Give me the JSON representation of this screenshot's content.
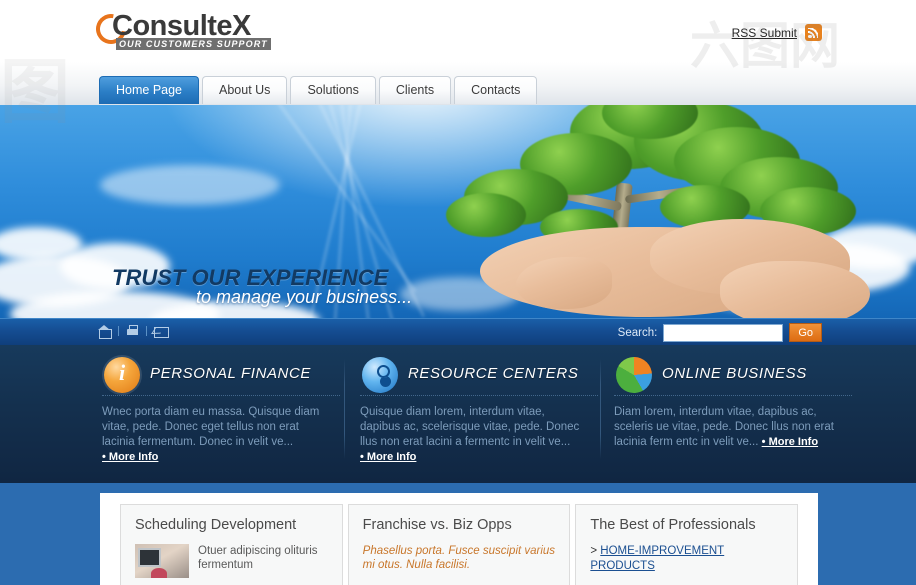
{
  "site": {
    "logo_word": "ConsulteX",
    "logo_tagline": "OUR CUSTOMERS SUPPORT",
    "logo_ring_color": "#e8741c"
  },
  "header": {
    "rss_label": "RSS Submit",
    "rss_icon": "rss-icon"
  },
  "nav": {
    "tabs": [
      {
        "label": "Home Page",
        "active": true
      },
      {
        "label": "About Us",
        "active": false
      },
      {
        "label": "Solutions",
        "active": false
      },
      {
        "label": "Clients",
        "active": false
      },
      {
        "label": "Contacts",
        "active": false
      }
    ],
    "active_color": "#1d6cb4"
  },
  "hero": {
    "title": "TRUST OUR EXPERIENCE",
    "subtitle": "to manage your business...",
    "title_color": "#123a63",
    "image_description": "hand-holding-tree"
  },
  "searchbar": {
    "quick_icons": [
      "home-icon",
      "print-icon",
      "mail-icon"
    ],
    "search_label": "Search:",
    "search_value": "",
    "search_placeholder": "",
    "go_label": "Go",
    "go_color": "#dd6c12"
  },
  "features": [
    {
      "icon": "info-icon",
      "title": "PERSONAL FINANCE",
      "body": "Wnec porta diam eu massa. Quisque diam vitae, pede. Donec eget tellus non erat lacinia fermentum. Donec in velit ve...",
      "more_label": "• More Info"
    },
    {
      "icon": "disc-search-icon",
      "title": "RESOURCE CENTERS",
      "body": "Quisque diam lorem, interdum vitae, dapibus ac, scelerisque vitae, pede. Donec llus non erat lacini a fermentc in velit ve...",
      "more_label": "• More Info"
    },
    {
      "icon": "pie-chart-icon",
      "title": "ONLINE BUSINESS",
      "body": "Diam lorem, interdum vitae, dapibus ac, sceleris ue vitae, pede. Donec llus non erat lacinia ferm entc in velit ve...",
      "more_label": "• More Info"
    }
  ],
  "cards": [
    {
      "title": "Scheduling Development",
      "thumb": "office-desk-thumbnail",
      "text": "Otuer adipiscing olituris  fermentum",
      "style": "plain"
    },
    {
      "title": "Franchise vs. Biz Opps",
      "text": "Phasellus porta. Fusce suscipit varius mi otus. Nulla facilisi.",
      "style": "orange-italic"
    },
    {
      "title": "The Best of Professionals",
      "link_prefix": ">",
      "link_text": "HOME-IMPROVEMENT PRODUCTS",
      "style": "link"
    }
  ],
  "watermarks": {
    "top_right": "六图网",
    "center": "图"
  }
}
